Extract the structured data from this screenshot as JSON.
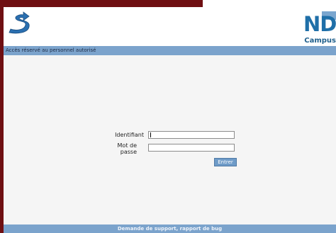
{
  "header": {
    "logo_icon": "s-arrow-logo-icon",
    "brand_title": "ND",
    "brand_subtitle": "Campus"
  },
  "banner": {
    "text": "Accès réservé au personnel autorisé"
  },
  "login": {
    "identifiant_label": "Identifiant",
    "password_label": "Mot de passe",
    "identifiant_value": "",
    "password_value": "",
    "submit_label": "Entrer"
  },
  "footer": {
    "link_text": "Demande de support, rapport de bug"
  },
  "colors": {
    "background_outer": "#6f0f12",
    "panel": "#f5f5f5",
    "bar": "#7ba3cc",
    "accent": "#1f6fa8"
  }
}
